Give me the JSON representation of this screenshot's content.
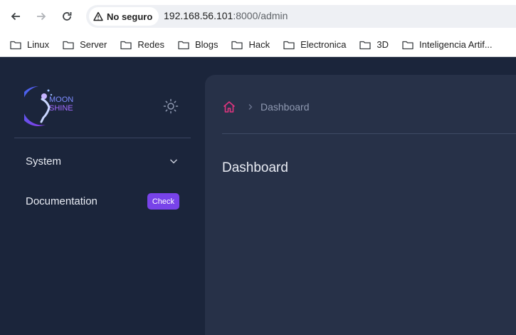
{
  "browser": {
    "back_icon": "arrow-left-icon",
    "forward_icon": "arrow-right-icon",
    "reload_icon": "reload-icon",
    "security_label": "No seguro",
    "url_host": "192.168.56.101",
    "url_rest": ":8000/admin"
  },
  "bookmarks": [
    {
      "label": "Linux"
    },
    {
      "label": "Server"
    },
    {
      "label": "Redes"
    },
    {
      "label": "Blogs"
    },
    {
      "label": "Hack"
    },
    {
      "label": "Electronica"
    },
    {
      "label": "3D"
    },
    {
      "label": "Inteligencia Artif..."
    }
  ],
  "sidebar": {
    "logo_text_top": "MOON",
    "logo_text_bottom": "SHINE",
    "theme_icon": "sun-icon",
    "items": [
      {
        "label": "System",
        "icon": "chevron-down-icon"
      },
      {
        "label": "Documentation",
        "badge": "Check"
      }
    ]
  },
  "main": {
    "breadcrumb": {
      "home_icon": "home-icon",
      "current": "Dashboard"
    },
    "title": "Dashboard"
  },
  "colors": {
    "sidebar_bg": "#1b253b",
    "content_bg": "#273148",
    "accent": "#7843e9",
    "home_icon": "#e0357f"
  }
}
